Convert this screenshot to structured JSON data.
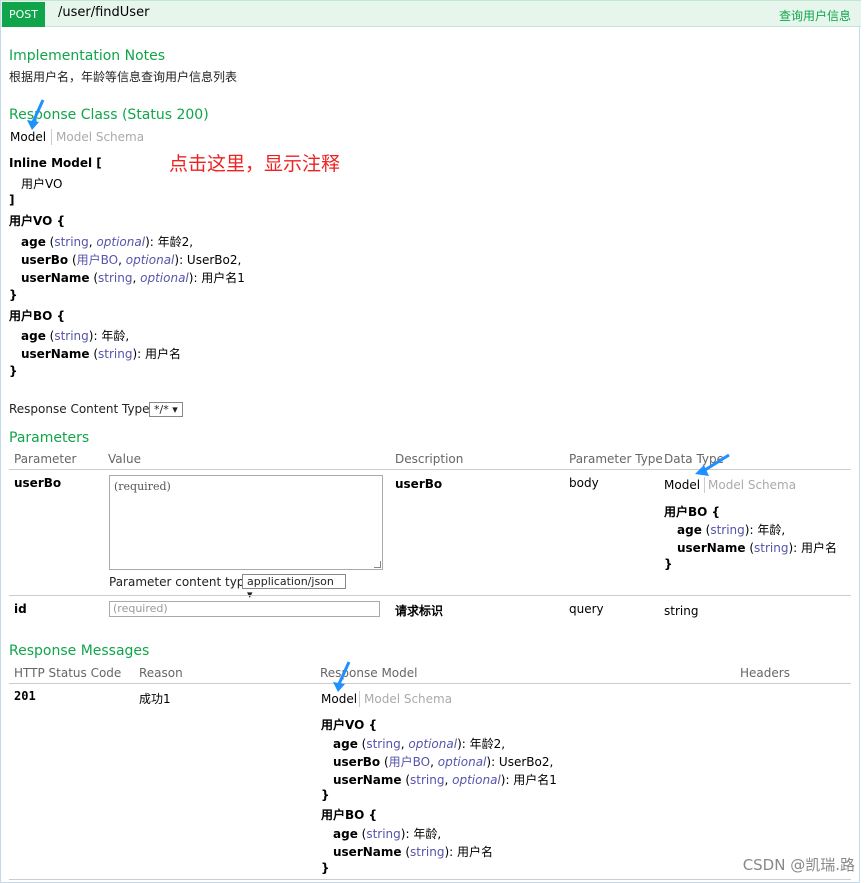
{
  "operation": {
    "method": "POST",
    "path": "/user/findUser",
    "summary": "查询用户信息"
  },
  "implementation_notes": {
    "heading": "Implementation Notes",
    "text": "根据用户名，年龄等信息查询用户信息列表"
  },
  "response_class": {
    "heading": "Response Class (Status 200)",
    "tab_model": "Model",
    "tab_schema": "Model Schema",
    "annotation": "点击这里，显示注释",
    "inline_model_open": "Inline Model [",
    "inline_model_item": "用户VO",
    "inline_model_close": "]",
    "vo_open": "用户VO {",
    "vo_fields": [
      {
        "name": "age",
        "type": "string",
        "opt": "optional",
        "desc": ": 年龄2,"
      },
      {
        "name": "userBo",
        "type": "用户BO",
        "opt": "optional",
        "desc": ": UserBo2,"
      },
      {
        "name": "userName",
        "type": "string",
        "opt": "optional",
        "desc": ": 用户名1"
      }
    ],
    "vo_close": "}",
    "bo_open": "用户BO {",
    "bo_fields": [
      {
        "name": "age",
        "type": "string",
        "desc": ": 年龄,"
      },
      {
        "name": "userName",
        "type": "string",
        "desc": ": 用户名"
      }
    ],
    "bo_close": "}"
  },
  "response_content_type": {
    "label": "Response Content Type",
    "value": "*/*"
  },
  "parameters": {
    "heading": "Parameters",
    "columns": [
      "Parameter",
      "Value",
      "Description",
      "Parameter Type",
      "Data Type"
    ],
    "rows": [
      {
        "name": "userBo",
        "placeholder": "(required)",
        "description": "userBo",
        "param_type": "body",
        "content_type_label": "Parameter content type:",
        "content_type_value": "application/json",
        "data_tab_model": "Model",
        "data_tab_schema": "Model Schema",
        "model_open": "用户BO {",
        "model_fields": [
          {
            "name": "age",
            "type": "string",
            "desc": ": 年龄,"
          },
          {
            "name": "userName",
            "type": "string",
            "desc": ": 用户名"
          }
        ],
        "model_close": "}"
      },
      {
        "name": "id",
        "placeholder": "(required)",
        "description": "请求标识",
        "param_type": "query",
        "data_type": "string"
      }
    ]
  },
  "response_messages": {
    "heading": "Response Messages",
    "columns": [
      "HTTP Status Code",
      "Reason",
      "Response Model",
      "Headers"
    ],
    "row": {
      "code": "201",
      "reason": "成功1",
      "tab_model": "Model",
      "tab_schema": "Model Schema",
      "vo_open": "用户VO {",
      "vo_fields": [
        {
          "name": "age",
          "type": "string",
          "opt": "optional",
          "desc": ": 年龄2,"
        },
        {
          "name": "userBo",
          "type": "用户BO",
          "opt": "optional",
          "desc": ": UserBo2,"
        },
        {
          "name": "userName",
          "type": "string",
          "opt": "optional",
          "desc": ": 用户名1"
        }
      ],
      "vo_close": "}",
      "bo_open": "用户BO {",
      "bo_fields": [
        {
          "name": "age",
          "type": "string",
          "desc": ": 年龄,"
        },
        {
          "name": "userName",
          "type": "string",
          "desc": ": 用户名"
        }
      ],
      "bo_close": "}"
    }
  },
  "watermark": "CSDN @凯瑞.路",
  "colors": {
    "accent_green": "#10a54a",
    "annotation_red": "#ee2222",
    "arrow_blue": "#1e90ff",
    "type_blue": "#5555aa"
  }
}
